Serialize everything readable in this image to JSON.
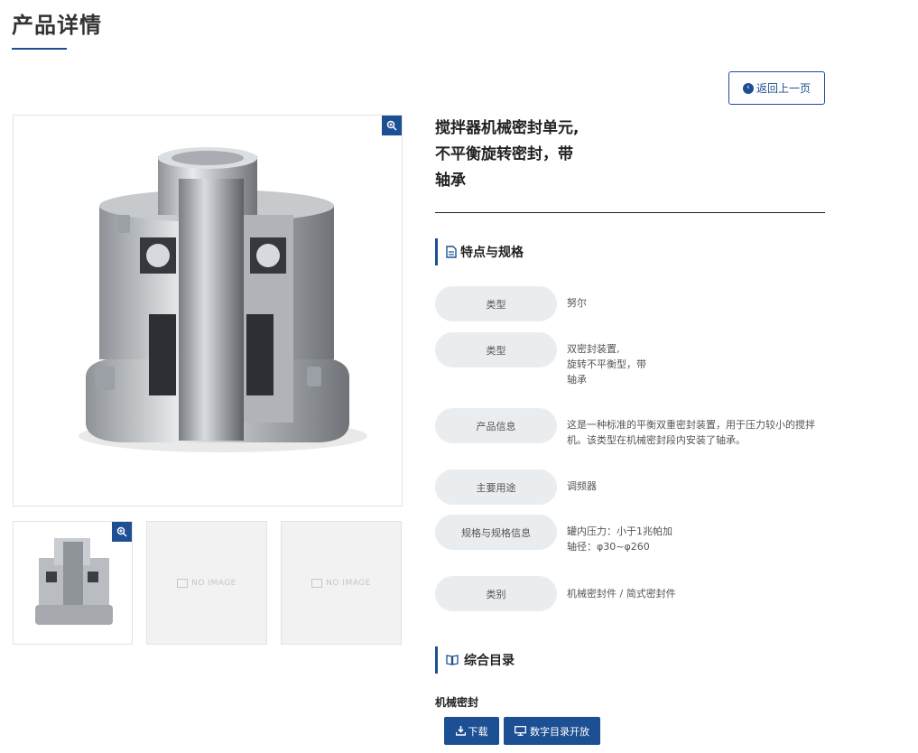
{
  "page": {
    "title": "产品详情"
  },
  "back_button": {
    "label": "返回上一页"
  },
  "product": {
    "title_lines": [
      "搅拌器机械密封单元,",
      "不平衡旋转密封，带",
      "轴承"
    ]
  },
  "thumbnails": {
    "no_image_label": "NO IMAGE"
  },
  "specs_section": {
    "heading": "特点与规格"
  },
  "specs": [
    {
      "label": "类型",
      "value": "努尔"
    },
    {
      "label": "类型",
      "value": "双密封装置,\n旋转不平衡型，带\n轴承"
    },
    {
      "label": "产品信息",
      "value": "这是一种标准的平衡双重密封装置，用于压力较小的搅拌\n机。该类型在机械密封段内安装了轴承。"
    },
    {
      "label": "主要用途",
      "value": "调频器"
    },
    {
      "label": "规格与规格信息",
      "value": "罐内压力：小于1兆帕加\n轴径：φ30~φ260"
    },
    {
      "label": "类别",
      "value": "机械密封件 / 简式密封件"
    }
  ],
  "catalog_section": {
    "heading": "综合目录",
    "category": "机械密封"
  },
  "buttons": {
    "download": "下载",
    "digital_catalog": "数字目录开放"
  },
  "colors": {
    "accent": "#1c4f93",
    "label_bg": "#eaedf0",
    "border": "#e3e3e3"
  }
}
